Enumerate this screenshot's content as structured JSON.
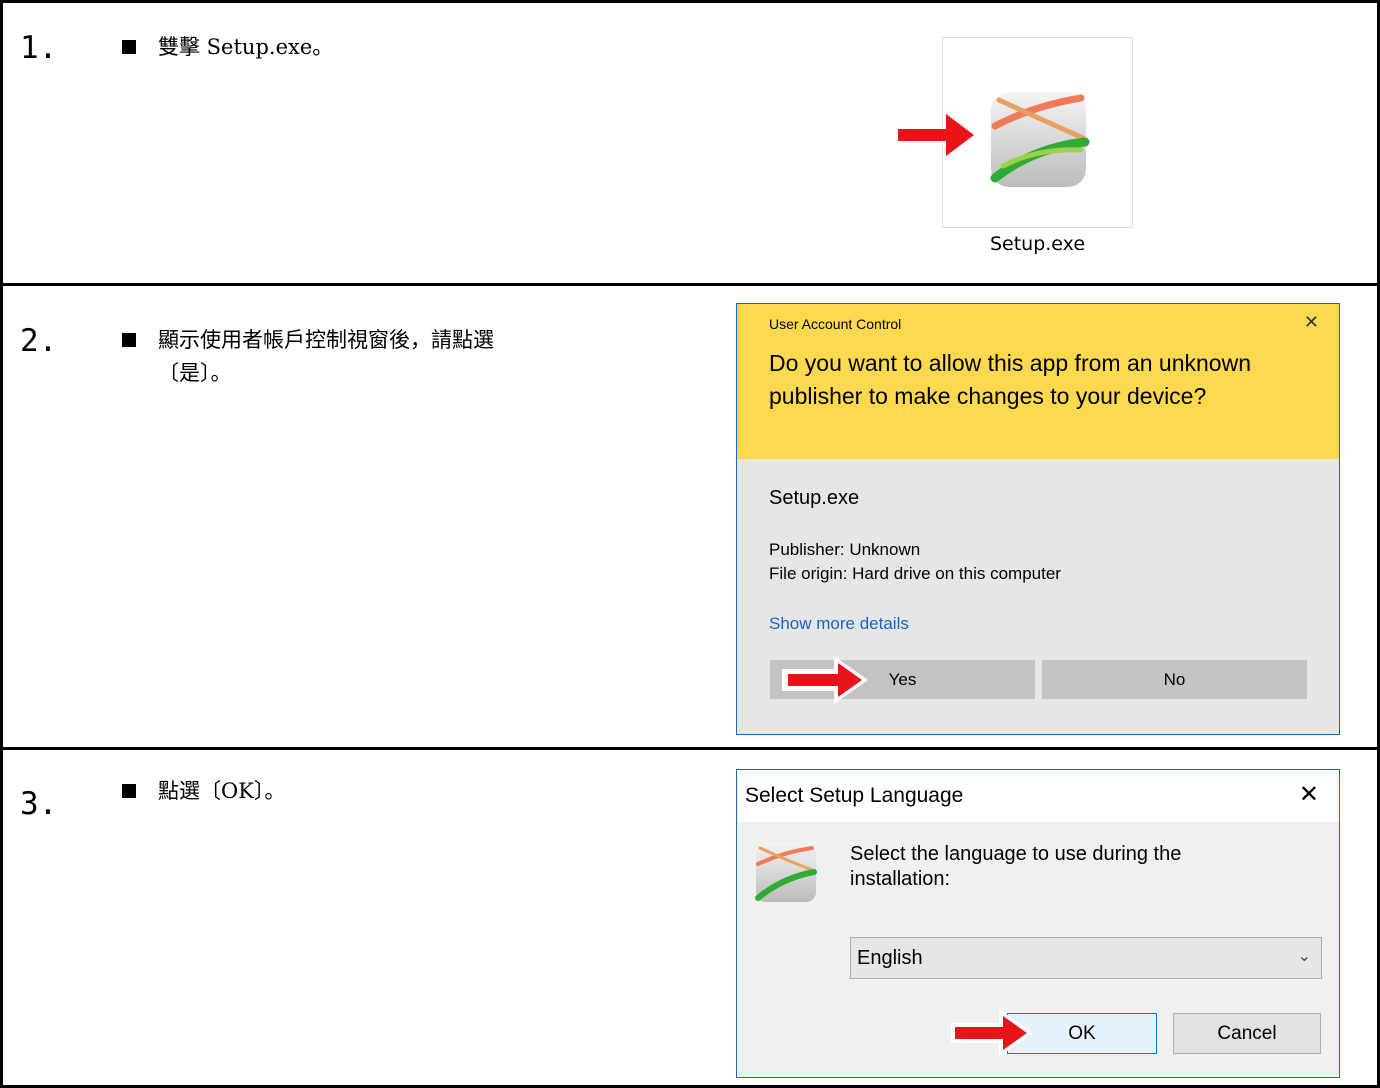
{
  "steps": [
    {
      "number": "1.",
      "instruction": "雙擊 Setup.exe。"
    },
    {
      "number": "2.",
      "instruction": "顯示使用者帳戶控制視窗後，請點選\n〔是〕。"
    },
    {
      "number": "3.",
      "instruction": "點選〔OK〕。"
    }
  ],
  "file_icon": {
    "caption": "Setup.exe"
  },
  "uac": {
    "title": "User Account Control",
    "close_glyph": "✕",
    "question": "Do you want to allow this app from an unknown publisher to make changes to your device?",
    "program": "Setup.exe",
    "publisher": "Publisher: Unknown",
    "origin": "File origin: Hard drive on this computer",
    "more_details": "Show more details",
    "yes_label": "Yes",
    "no_label": "No"
  },
  "language_dialog": {
    "title": "Select Setup Language",
    "close_glyph": "✕",
    "message": "Select the language to use during the installation:",
    "selected_language": "English",
    "ok_label": "OK",
    "cancel_label": "Cancel"
  },
  "colors": {
    "uac_header": "#fcd94e",
    "arrow": "#e8141a",
    "link": "#1565c0",
    "dialog_border": "#1a66c4"
  }
}
